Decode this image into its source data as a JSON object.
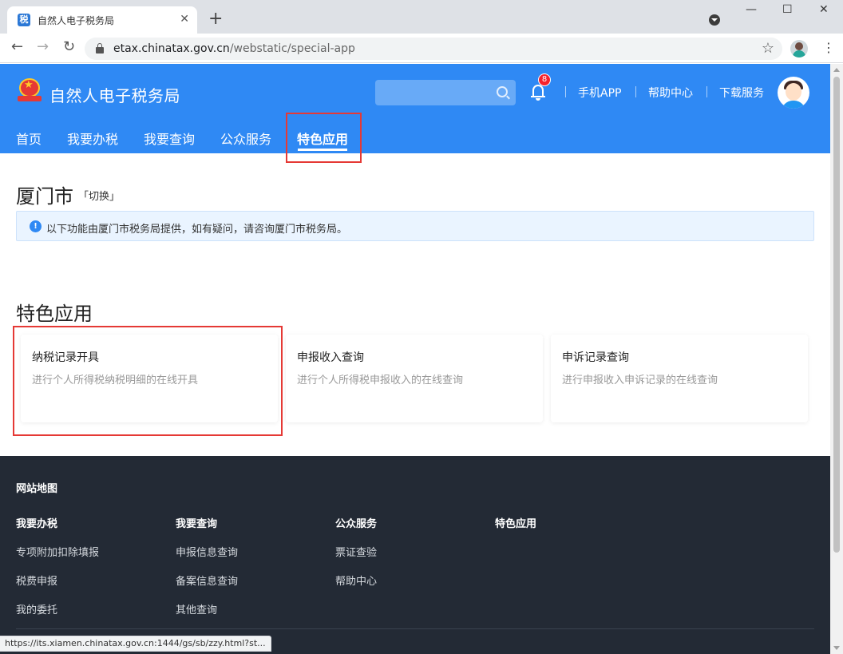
{
  "browser": {
    "tab": {
      "favicon": "税",
      "title": "自然人电子税务局",
      "close": "✕"
    },
    "new_tab": "+",
    "window": {
      "minimize": "—",
      "maximize": "☐",
      "close": "✕"
    },
    "nav": {
      "back": "←",
      "forward": "→",
      "reload": "↻"
    },
    "url": {
      "host": "etax.chinatax.gov.cn",
      "path": "/webstatic/special-app"
    },
    "bookmark_star": "☆",
    "menu": "⋮",
    "status_url": "https://its.xiamen.chinatax.gov.cn:1444/gs/sb/zzy.html?st..."
  },
  "header": {
    "site_title": "自然人电子税务局",
    "notification_count": "8",
    "links": [
      "手机APP",
      "帮助中心",
      "下载服务"
    ],
    "nav": [
      "首页",
      "我要办税",
      "我要查询",
      "公众服务",
      "特色应用"
    ],
    "active_nav": "特色应用",
    "brand_color": "#2f89f4"
  },
  "location": {
    "city": "厦门市",
    "switch_label": "「切换」",
    "notice": "以下功能由厦门市税务局提供，如有疑问，请咨询厦门市税务局。"
  },
  "special_apps": {
    "title": "特色应用",
    "cards": [
      {
        "title": "纳税记录开具",
        "desc": "进行个人所得税纳税明细的在线开具"
      },
      {
        "title": "申报收入查询",
        "desc": "进行个人所得税申报收入的在线查询"
      },
      {
        "title": "申诉记录查询",
        "desc": "进行申报收入申诉记录的在线查询"
      }
    ]
  },
  "footer": {
    "heading": "网站地图",
    "columns": [
      {
        "title": "我要办税",
        "links": [
          "专项附加扣除填报",
          "税费申报",
          "我的委托"
        ]
      },
      {
        "title": "我要查询",
        "links": [
          "申报信息查询",
          "备案信息查询",
          "其他查询"
        ]
      },
      {
        "title": "公众服务",
        "links": [
          "票证查验",
          "帮助中心"
        ]
      },
      {
        "title": "特色应用",
        "links": []
      }
    ]
  }
}
